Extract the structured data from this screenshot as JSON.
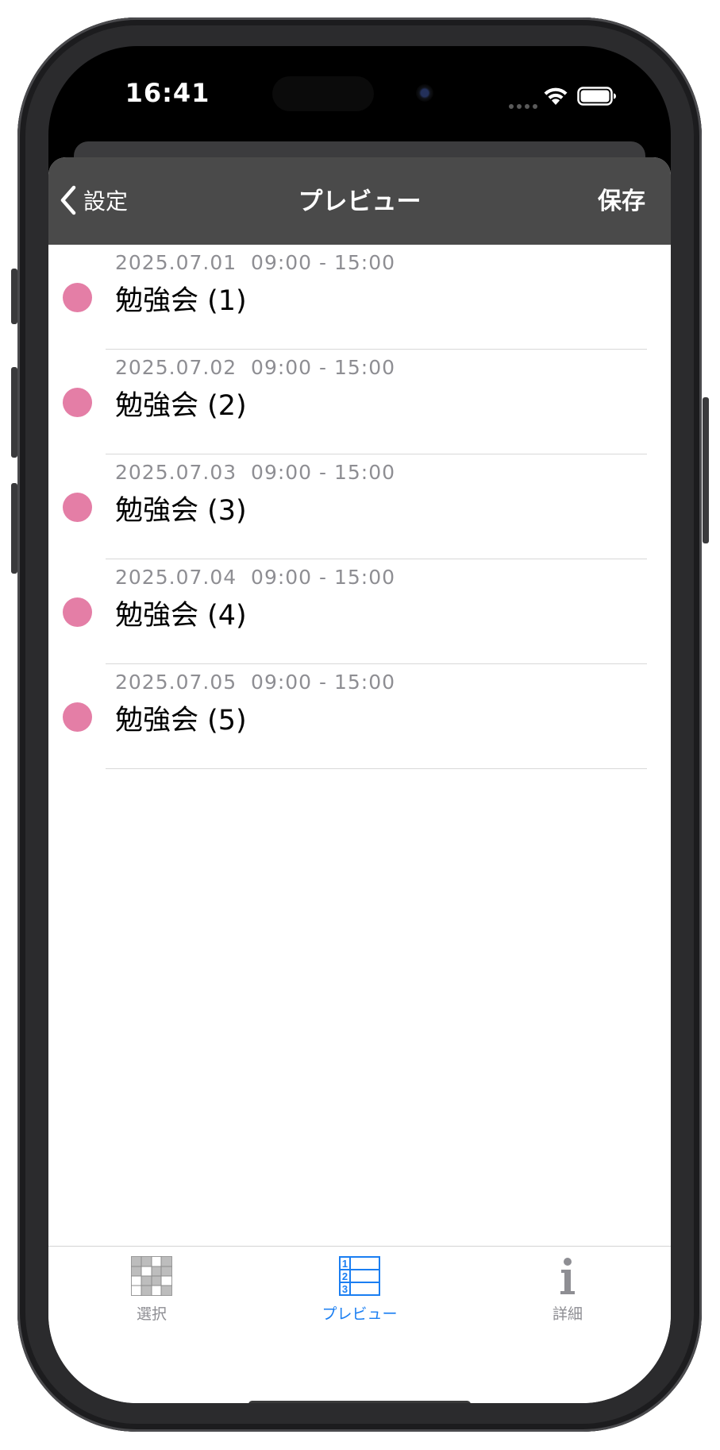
{
  "status_bar": {
    "time": "16:41"
  },
  "nav": {
    "back_label": "設定",
    "title": "プレビュー",
    "save_label": "保存"
  },
  "events": [
    {
      "datetime": "2025.07.01  09:00 - 15:00",
      "title": "勉強会 (1)"
    },
    {
      "datetime": "2025.07.02  09:00 - 15:00",
      "title": "勉強会 (2)"
    },
    {
      "datetime": "2025.07.03  09:00 - 15:00",
      "title": "勉強会 (3)"
    },
    {
      "datetime": "2025.07.04  09:00 - 15:00",
      "title": "勉強会 (4)"
    },
    {
      "datetime": "2025.07.05  09:00 - 15:00",
      "title": "勉強会 (5)"
    }
  ],
  "event_dot_color": "#e47ea6",
  "tabs": [
    {
      "label": "選択",
      "icon": "grid-select-icon",
      "active": false
    },
    {
      "label": "プレビュー",
      "icon": "numbered-list-icon",
      "active": true
    },
    {
      "label": "詳細",
      "icon": "info-icon",
      "active": false
    }
  ],
  "colors": {
    "nav_background": "#4a4a4a",
    "tab_active": "#1a7ef2",
    "tab_inactive": "#8e8e93"
  }
}
